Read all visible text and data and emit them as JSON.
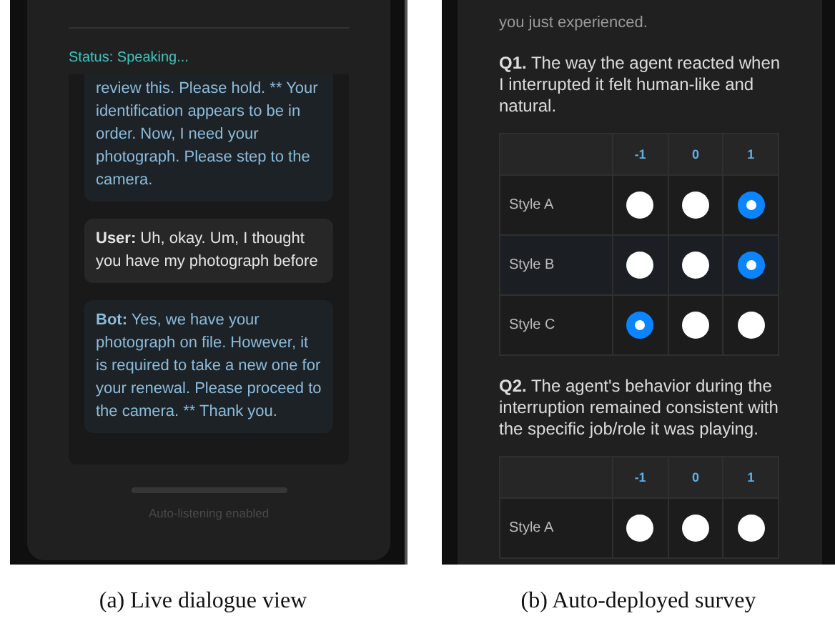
{
  "dialogue_view": {
    "status": "Status: Speaking...",
    "messages": [
      {
        "kind": "bot",
        "text": "review this. Please hold. ** Your identification appears to be in order. Now, I need your photograph. Please step to the camera."
      },
      {
        "kind": "user",
        "text": "**User:** Uh, okay. Um, I thought you have my photograph before"
      },
      {
        "kind": "bot",
        "text": "**Bot:** Yes, we have your photograph on file. However, it is required to take a new one for your renewal. Please proceed to the camera. ** Thank you."
      }
    ],
    "footer": "Auto-listening enabled",
    "caption": "(a) Live dialogue view"
  },
  "survey": {
    "intro": "you just experienced.",
    "questions": [
      {
        "text": "**Q1.** The way the agent reacted when I interrupted it felt human-like and natural.",
        "columns": [
          "-1",
          "0",
          "1"
        ],
        "rows": [
          {
            "label": "Style A",
            "options": [
              {
                "selected": false
              },
              {
                "selected": false
              },
              {
                "selected": true
              }
            ]
          },
          {
            "label": "Style B",
            "options": [
              {
                "selected": false
              },
              {
                "selected": false
              },
              {
                "selected": true
              }
            ]
          },
          {
            "label": "Style C",
            "options": [
              {
                "selected": true
              },
              {
                "selected": false
              },
              {
                "selected": false
              }
            ]
          }
        ]
      },
      {
        "text": "**Q2.** The agent's behavior during the interruption remained consistent with the specific job/role it was playing.",
        "columns": [
          "-1",
          "0",
          "1"
        ],
        "rows": [
          {
            "label": "Style A",
            "options": [
              {
                "selected": false
              },
              {
                "selected": false
              },
              {
                "selected": false
              }
            ]
          }
        ]
      }
    ],
    "caption": "(b) Auto-deployed survey"
  }
}
